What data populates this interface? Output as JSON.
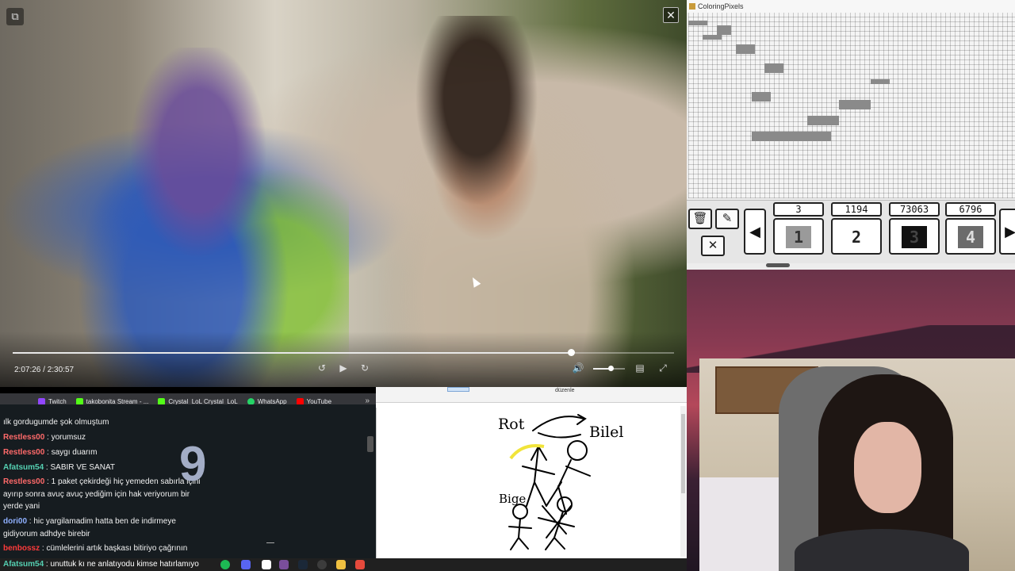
{
  "video": {
    "time": "2:07:26 / 2:30:57",
    "progress": 0.8438,
    "volume": 0.55,
    "icons": {
      "corner": "picture-in-picture-icon",
      "close": "close-icon",
      "rewind": "rewind-10-icon",
      "play": "play-icon",
      "forward": "forward-10-icon",
      "volume": "volume-icon",
      "captions": "captions-icon",
      "fullscreen": "fullscreen-icon"
    }
  },
  "coloring_pixels": {
    "title": "ColoringPixels",
    "tools": {
      "trash": "trash-icon",
      "eraser": "eraser-icon",
      "cancel": "close-icon",
      "prev": "arrow-left-icon",
      "next": "arrow-right-icon"
    },
    "swatches": [
      {
        "count": "3",
        "number": "1",
        "selected": false
      },
      {
        "count": "1194",
        "number": "2",
        "selected": false
      },
      {
        "count": "73063",
        "number": "3",
        "selected": true
      },
      {
        "count": "6796",
        "number": "4",
        "selected": false
      }
    ]
  },
  "bookmarks": [
    {
      "label": "Twitch",
      "color": "#9146ff"
    },
    {
      "label": "takobonita Stream - ...",
      "color": "#53fc18"
    },
    {
      "label": "Crystal_LoL  Crystal_LoL",
      "color": "#53fc18"
    },
    {
      "label": "WhatsApp",
      "color": "#25d366"
    },
    {
      "label": "YouTube",
      "color": "#ff0000"
    }
  ],
  "chat": {
    "counter": "9",
    "messages": [
      {
        "user": "",
        "user_color": "#ff6a6a",
        "text": "ılk gordugumde şok olmuştum"
      },
      {
        "user": "Restless00",
        "user_color": "#ff6a6a",
        "text": " : yorumsuz"
      },
      {
        "user": "Restless00",
        "user_color": "#ff6a6a",
        "text": " : saygı duarım"
      },
      {
        "user": "Afatsum54",
        "user_color": "#55d0b2",
        "text": " : SABIR VE SANAT"
      },
      {
        "user": "Restless00",
        "user_color": "#ff6a6a",
        "text": " : 1 paket çekirdeği hiç yemeden sabırla içini ayırıp sonra avuç avuç yediğim için hak veriyorum bir yerde yani"
      },
      {
        "user": "dori00",
        "user_color": "#8fb0ff",
        "text": " : hic yargilamadim hatta ben de indirmeye gidiyorum adhdye birebir"
      },
      {
        "user": "benbossz",
        "user_color": "#ff3b3b",
        "text": " : cümlelerini artık başkası bitiriyo çağrının"
      }
    ]
  },
  "paint": {
    "ribbon_label": "düzenle",
    "labels": [
      "Rot",
      "Bilel",
      "Bige"
    ]
  },
  "taskbar": {
    "user": "Afatsum54",
    "text": " : unuttuk kı ne anlatıyodu kimse hatırlamıyo"
  }
}
